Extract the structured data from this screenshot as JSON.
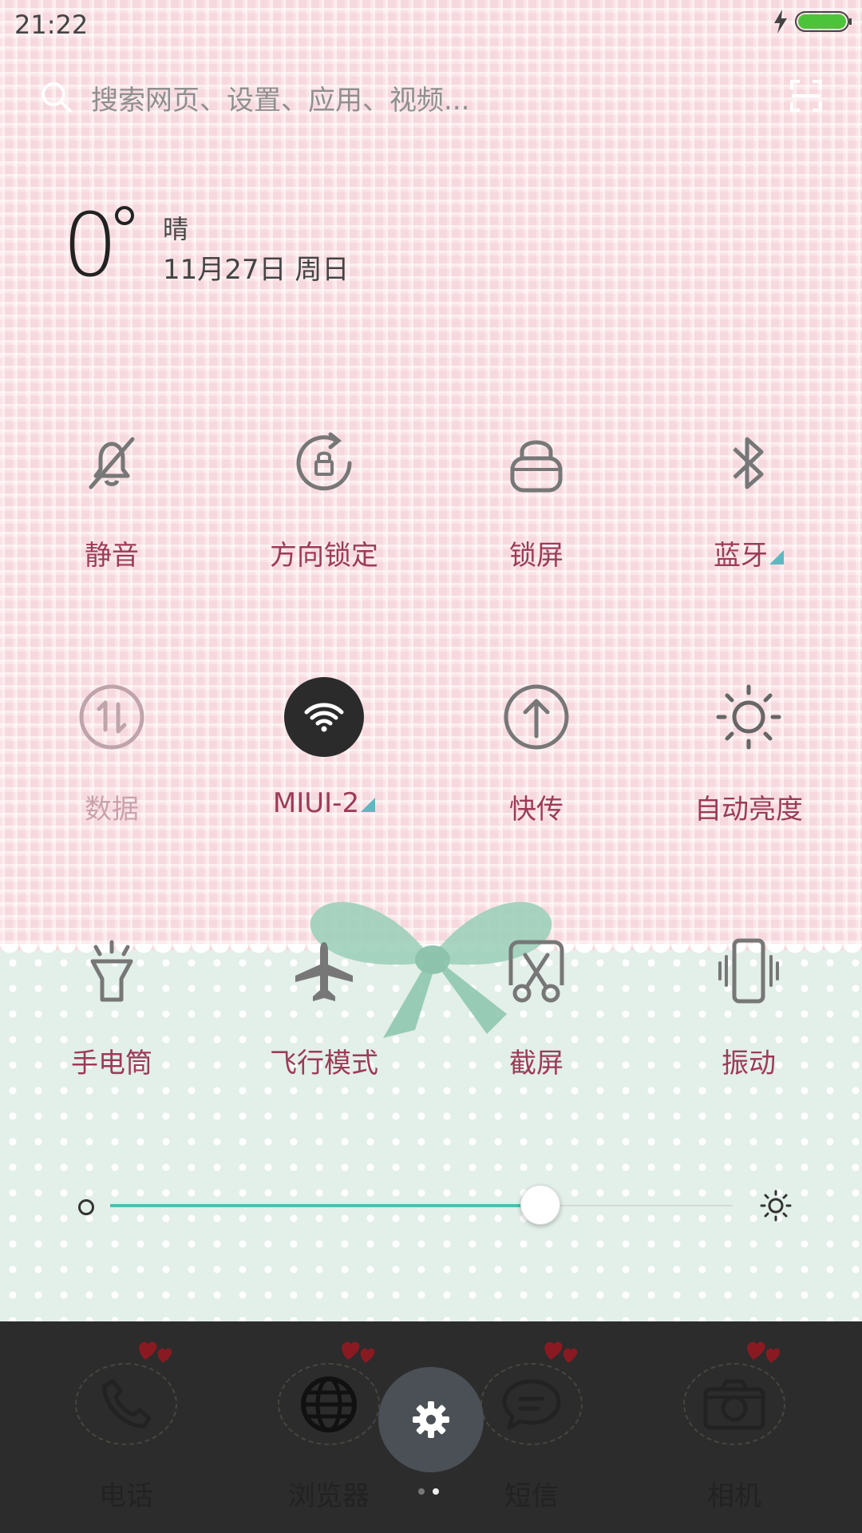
{
  "status_bar": {
    "time": "21:22",
    "battery_color": "#4bc43a"
  },
  "search": {
    "placeholder": "搜索网页、设置、应用、视频..."
  },
  "weather": {
    "temperature": "0",
    "condition": "晴",
    "date": "11月27日 周日"
  },
  "toggles": [
    {
      "label": "静音",
      "icon": "bell-off-icon",
      "state": "off"
    },
    {
      "label": "方向锁定",
      "icon": "rotation-lock-icon",
      "state": "off"
    },
    {
      "label": "锁屏",
      "icon": "lock-icon",
      "state": "off"
    },
    {
      "label": "蓝牙",
      "icon": "bluetooth-icon",
      "state": "off",
      "has_menu": true
    },
    {
      "label": "数据",
      "icon": "mobile-data-icon",
      "state": "disabled"
    },
    {
      "label": "MIUI-2",
      "icon": "wifi-icon",
      "state": "on",
      "has_menu": true
    },
    {
      "label": "快传",
      "icon": "upload-icon",
      "state": "off"
    },
    {
      "label": "自动亮度",
      "icon": "sun-icon",
      "state": "off"
    },
    {
      "label": "手电筒",
      "icon": "flashlight-icon",
      "state": "off"
    },
    {
      "label": "飞行模式",
      "icon": "airplane-icon",
      "state": "off"
    },
    {
      "label": "截屏",
      "icon": "screenshot-icon",
      "state": "off"
    },
    {
      "label": "振动",
      "icon": "vibrate-icon",
      "state": "off"
    }
  ],
  "brightness": {
    "level": 0.69,
    "accent": "#49c1b4"
  },
  "dock": {
    "apps": [
      {
        "label": "电话",
        "icon": "phone-icon"
      },
      {
        "label": "浏览器",
        "icon": "globe-icon"
      },
      {
        "label": "短信",
        "icon": "message-icon"
      },
      {
        "label": "相机",
        "icon": "camera-icon"
      }
    ],
    "settings_icon": "gear-icon",
    "pages": 2,
    "active_page": 2
  },
  "colors": {
    "label": "#9c3b58",
    "label_disabled": "#caa1ac",
    "wifi_active": "#2b2b2b"
  }
}
